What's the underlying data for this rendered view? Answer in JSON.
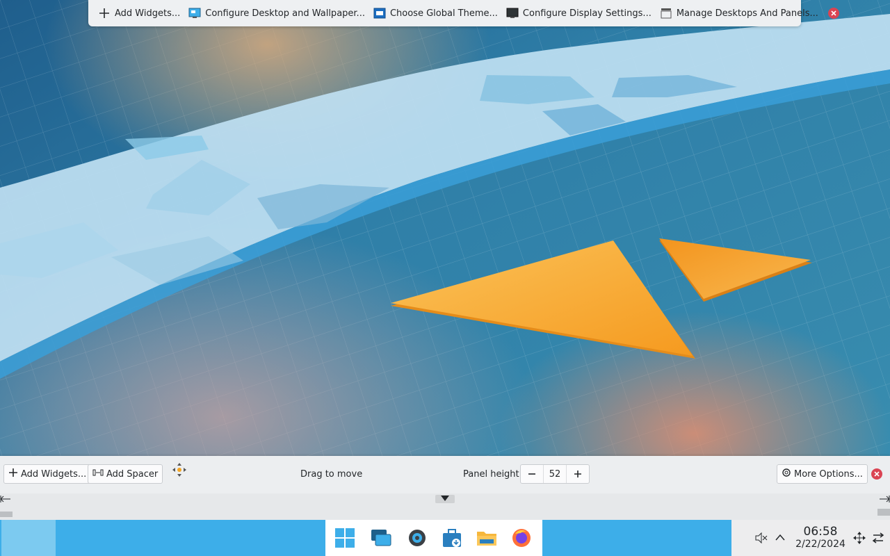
{
  "top_toolbar": {
    "add_widgets": "Add Widgets...",
    "configure_desktop": "Configure Desktop and Wallpaper...",
    "global_theme": "Choose Global Theme...",
    "display_settings": "Configure Display Settings...",
    "manage_desktops": "Manage Desktops And Panels..."
  },
  "panel_edit": {
    "add_widgets": "Add Widgets...",
    "add_spacer": "Add Spacer",
    "drag_to_move": "Drag to move",
    "panel_height_label": "Panel height:",
    "panel_height_value": "52",
    "more_options": "More Options..."
  },
  "taskbar": {
    "icons": [
      "windows-start-icon",
      "window-overview-icon",
      "system-settings-icon",
      "discover-store-icon",
      "file-manager-icon",
      "firefox-icon"
    ]
  },
  "tray": {
    "time": "06:58",
    "date": "2/22/2024"
  },
  "colors": {
    "panel_blue": "#3daee9",
    "close_red": "#da4453",
    "accent_orange": "#f5a623"
  }
}
